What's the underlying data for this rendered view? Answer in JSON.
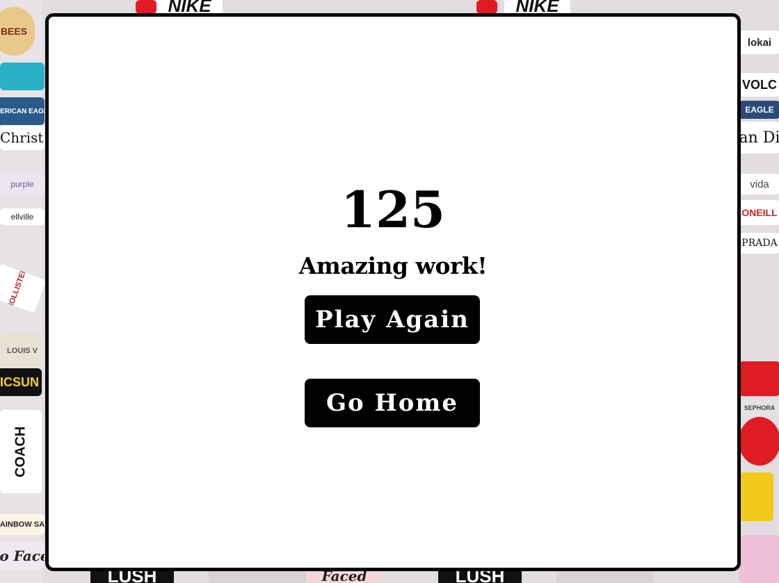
{
  "result": {
    "score": "125",
    "message": "Amazing work!"
  },
  "actions": {
    "play_again_label": "Play Again",
    "go_home_label": "Go Home"
  },
  "background": {
    "stickers": [
      "NIKE",
      "NIKE",
      "BEES",
      "Christ",
      "AMERICAN EAGLE",
      "HOLLISTER",
      "LOUIS V",
      "COACH",
      "RAINBOW SA",
      "LUSH",
      "LUSH",
      "Faced",
      "Too Faced",
      "lokai",
      "VOLC",
      "EAGLE",
      "an Di",
      "vida",
      "ONEILL",
      "PRADA",
      "SEPHORA",
      "purple",
      "ellville",
      "ICSUN"
    ]
  },
  "colors": {
    "panel_bg": "#ffffff",
    "panel_border": "#000000",
    "button_bg": "#000000",
    "button_text": "#ffffff"
  }
}
